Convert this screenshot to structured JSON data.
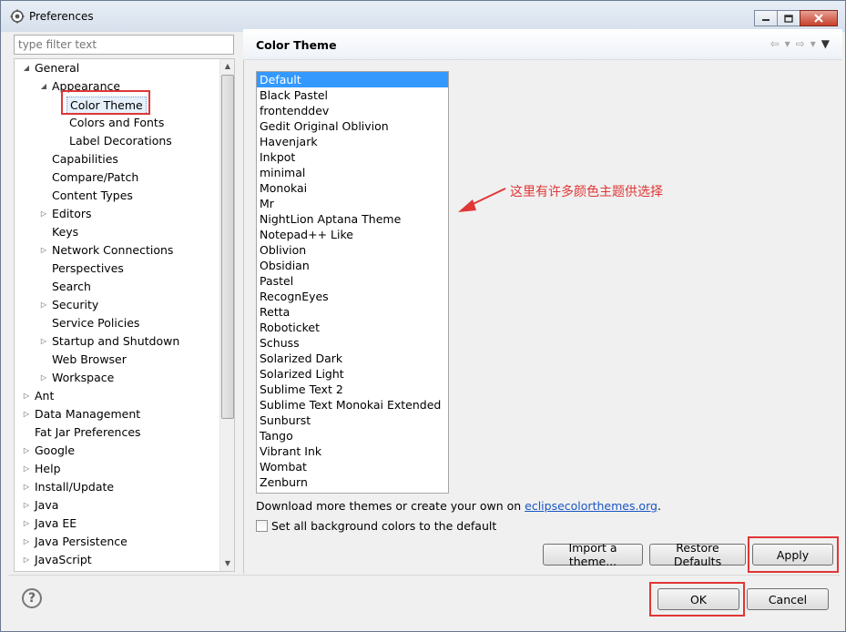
{
  "window": {
    "title": "Preferences"
  },
  "filter": {
    "placeholder": "type filter text"
  },
  "tree": [
    {
      "label": "General",
      "indent": 0,
      "twisty": "expanded"
    },
    {
      "label": "Appearance",
      "indent": 1,
      "twisty": "expanded"
    },
    {
      "label": "Color Theme",
      "indent": 2,
      "twisty": "none",
      "selected": true
    },
    {
      "label": "Colors and Fonts",
      "indent": 2,
      "twisty": "none"
    },
    {
      "label": "Label Decorations",
      "indent": 2,
      "twisty": "none"
    },
    {
      "label": "Capabilities",
      "indent": 1,
      "twisty": "none"
    },
    {
      "label": "Compare/Patch",
      "indent": 1,
      "twisty": "none"
    },
    {
      "label": "Content Types",
      "indent": 1,
      "twisty": "none"
    },
    {
      "label": "Editors",
      "indent": 1,
      "twisty": "collapsed"
    },
    {
      "label": "Keys",
      "indent": 1,
      "twisty": "none"
    },
    {
      "label": "Network Connections",
      "indent": 1,
      "twisty": "collapsed"
    },
    {
      "label": "Perspectives",
      "indent": 1,
      "twisty": "none"
    },
    {
      "label": "Search",
      "indent": 1,
      "twisty": "none"
    },
    {
      "label": "Security",
      "indent": 1,
      "twisty": "collapsed"
    },
    {
      "label": "Service Policies",
      "indent": 1,
      "twisty": "none"
    },
    {
      "label": "Startup and Shutdown",
      "indent": 1,
      "twisty": "collapsed"
    },
    {
      "label": "Web Browser",
      "indent": 1,
      "twisty": "none"
    },
    {
      "label": "Workspace",
      "indent": 1,
      "twisty": "collapsed"
    },
    {
      "label": "Ant",
      "indent": 0,
      "twisty": "collapsed"
    },
    {
      "label": "Data Management",
      "indent": 0,
      "twisty": "collapsed"
    },
    {
      "label": "Fat Jar Preferences",
      "indent": 0,
      "twisty": "none"
    },
    {
      "label": "Google",
      "indent": 0,
      "twisty": "collapsed"
    },
    {
      "label": "Help",
      "indent": 0,
      "twisty": "collapsed"
    },
    {
      "label": "Install/Update",
      "indent": 0,
      "twisty": "collapsed"
    },
    {
      "label": "Java",
      "indent": 0,
      "twisty": "collapsed"
    },
    {
      "label": "Java EE",
      "indent": 0,
      "twisty": "collapsed"
    },
    {
      "label": "Java Persistence",
      "indent": 0,
      "twisty": "collapsed"
    },
    {
      "label": "JavaScript",
      "indent": 0,
      "twisty": "collapsed"
    }
  ],
  "page": {
    "title": "Color Theme"
  },
  "themes": [
    "Default",
    "Black Pastel",
    "frontenddev",
    "Gedit Original Oblivion",
    "Havenjark",
    "Inkpot",
    "minimal",
    "Monokai",
    "Mr",
    "NightLion Aptana Theme",
    "Notepad++ Like",
    "Oblivion",
    "Obsidian",
    "Pastel",
    "RecognEyes",
    "Retta",
    "Roboticket",
    "Schuss",
    "Solarized Dark",
    "Solarized Light",
    "Sublime Text 2",
    "Sublime Text Monokai Extended",
    "Sunburst",
    "Tango",
    "Vibrant Ink",
    "Wombat",
    "Zenburn"
  ],
  "selected_theme": "Default",
  "annotation": "这里有许多颜色主题供选择",
  "download": {
    "prefix": "Download more themes or create your own on ",
    "link": "eclipsecolorthemes.org",
    "suffix": "."
  },
  "checkbox": {
    "label": "Set all background colors to the default",
    "checked": false
  },
  "buttons": {
    "import": "Import a theme...",
    "restore": "Restore Defaults",
    "apply": "Apply",
    "ok": "OK",
    "cancel": "Cancel"
  },
  "colors": {
    "selection": "#3399ff",
    "annotation": "#e03636",
    "link": "#1a55c4"
  }
}
